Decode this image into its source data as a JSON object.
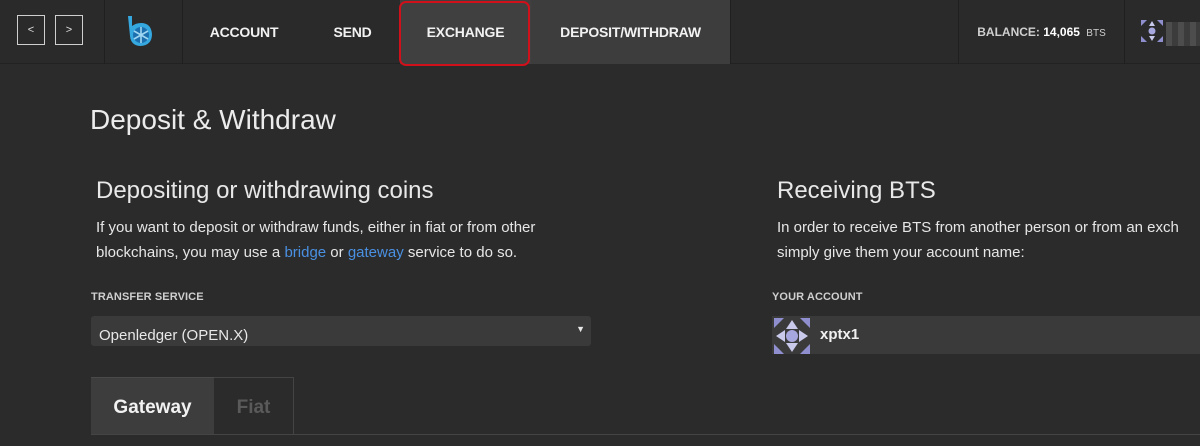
{
  "nav": {
    "back_label": "<",
    "forward_label": ">",
    "logo_icon": "bitshares-logo-icon",
    "menu": [
      {
        "label": "ACCOUNT"
      },
      {
        "label": "SEND"
      },
      {
        "label": "EXCHANGE"
      },
      {
        "label": "DEPOSIT/WITHDRAW"
      }
    ],
    "balance": {
      "label": "BALANCE:",
      "value": "14,065",
      "unit": "BTS"
    },
    "account_icon": "identicon-avatar-icon",
    "highlight_color": "#d0101a"
  },
  "page": {
    "title": "Deposit & Withdraw"
  },
  "depositing": {
    "title": "Depositing or withdrawing coins",
    "line1": "If you want to deposit or withdraw funds, either in fiat or from other",
    "line2_prefix": "blockchains, you may use a ",
    "bridge_link": "bridge",
    "or_text": " or ",
    "gateway_link": "gateway",
    "line2_suffix": " service to do so.",
    "transfer_label": "TRANSFER SERVICE",
    "transfer_value": "Openledger (OPEN.X)",
    "link_color": "#4a90e2"
  },
  "receiving": {
    "title": "Receiving BTS",
    "line1": "In order to receive BTS from another person or from an exch",
    "line2": "simply give them your account name:",
    "account_label": "YOUR ACCOUNT",
    "account_name": "xptx1"
  },
  "tabs": [
    {
      "label": "Gateway",
      "active": true
    },
    {
      "label": "Fiat",
      "active": false
    }
  ]
}
